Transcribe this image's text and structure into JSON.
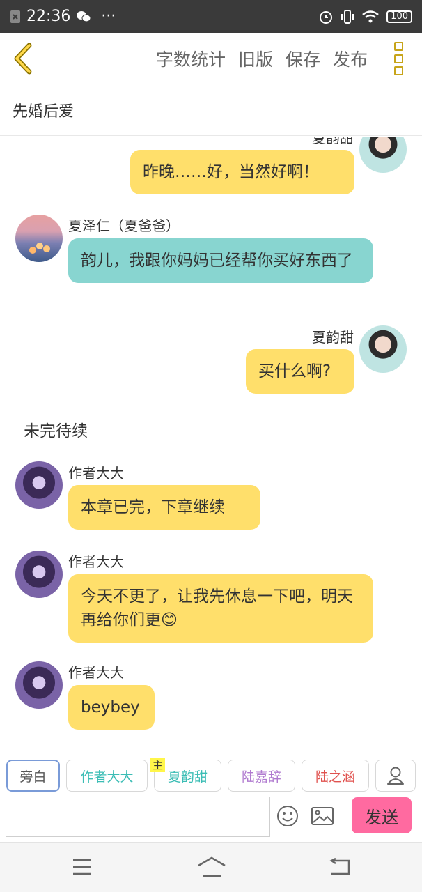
{
  "status": {
    "time": "22:36",
    "dots": "···",
    "battery": "100"
  },
  "toolbar": {
    "items": [
      "字数统计",
      "旧版",
      "保存",
      "发布"
    ]
  },
  "story": {
    "title": "先婚后爱"
  },
  "messages": [
    {
      "name": "夏韵甜",
      "text": "昨晚……好，当然好啊！"
    },
    {
      "name": "夏泽仁（夏爸爸）",
      "text": "韵儿，我跟你妈妈已经帮你买好东西了"
    },
    {
      "name": "夏韵甜",
      "text": "买什么啊?"
    },
    {
      "text": "未完待续"
    },
    {
      "name": "作者大大",
      "text": "本章已完，下章继续"
    },
    {
      "name": "作者大大",
      "text": "今天不更了，让我先休息一下吧，明天再给你们更😊"
    },
    {
      "name": "作者大大",
      "text": "beybey"
    }
  ],
  "roles": [
    {
      "label": "旁白",
      "color": "#555555"
    },
    {
      "label": "作者大大",
      "color": "#3bbdb5"
    },
    {
      "label": "夏韵甜",
      "color": "#3bbdb5",
      "tag": "主"
    },
    {
      "label": "陆嘉辞",
      "color": "#b07ad0"
    },
    {
      "label": "陆之涵",
      "color": "#e0524f"
    }
  ],
  "input": {
    "value": "",
    "placeholder": "",
    "send_label": "发送"
  },
  "colors": {
    "accent": "#ffdf6b",
    "teal": "#88d5d0",
    "send": "#ff6aa0"
  }
}
